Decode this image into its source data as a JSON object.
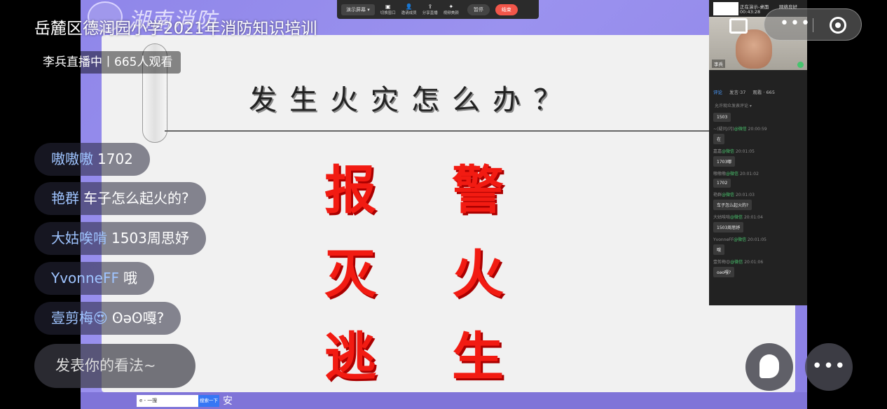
{
  "live": {
    "title": "岳麓区德润园小学2021年消防知识培训",
    "status": "李兵直播中丨665人观看"
  },
  "stage": {
    "logo_text": "湖南消防",
    "slide_title": "发生火灾怎么办？",
    "words": [
      "报",
      "警",
      "灭",
      "火",
      "逃",
      "生"
    ]
  },
  "presenter_toolbar": {
    "present_label": "演示屏幕 ▾",
    "tools": [
      {
        "icon": "camera-icon",
        "label": "切换窗口"
      },
      {
        "icon": "person-icon",
        "label": "邀请成员"
      },
      {
        "icon": "share-icon",
        "label": "分享直播"
      },
      {
        "icon": "beauty-icon",
        "label": "视频美颜"
      }
    ],
    "pause_label": "暂停",
    "end_label": "结束"
  },
  "side_panel": {
    "sharing": "正在演示-桌面",
    "timer": "00:43:28",
    "network": "网络良好",
    "host_name": "李兵",
    "tabs": [
      "评论",
      "发言·37",
      "观看 · 665"
    ],
    "allow_comments": "允许观众发表评论 ▾",
    "messages": [
      {
        "user": "",
        "source": "",
        "time": "",
        "text": "1503"
      },
      {
        "user": "~(疑问/闪)",
        "source": "@微信",
        "time": "20:00:59",
        "text": "在"
      },
      {
        "user": "嘉嘉",
        "source": "@微信",
        "time": "20:01:05",
        "text": "1703哪"
      },
      {
        "user": "嗷嗷嗷",
        "source": "@微信",
        "time": "20:01:02",
        "text": "1702"
      },
      {
        "user": "艳群",
        "source": "@微信",
        "time": "20:01:03",
        "text": "车子怎么起火的?"
      },
      {
        "user": "大姑唉啃",
        "source": "@微信",
        "time": "20:01:04",
        "text": "1503周思妤"
      },
      {
        "user": "YvonneFF",
        "source": "@微信",
        "time": "20:01:05",
        "text": "哦"
      },
      {
        "user": "壹剪梅😍",
        "source": "@微信",
        "time": "20:01:06",
        "text": "oəo嘎?"
      }
    ]
  },
  "comments": [
    {
      "user": "嗷嗷嗷",
      "text": "1702"
    },
    {
      "user": "艳群",
      "text": "车子怎么起火的?"
    },
    {
      "user": "大姑唉啃",
      "text": "1503周思妤"
    },
    {
      "user": "YvonneFF",
      "text": "哦"
    },
    {
      "user": "壹剪梅😍",
      "text": "ʘəʘ嘎?"
    }
  ],
  "comment_input": {
    "placeholder": "发表你的看法~"
  },
  "taskbar": {
    "search_text": "e - 一搜",
    "search_button": "搜索一下",
    "note": "安"
  }
}
